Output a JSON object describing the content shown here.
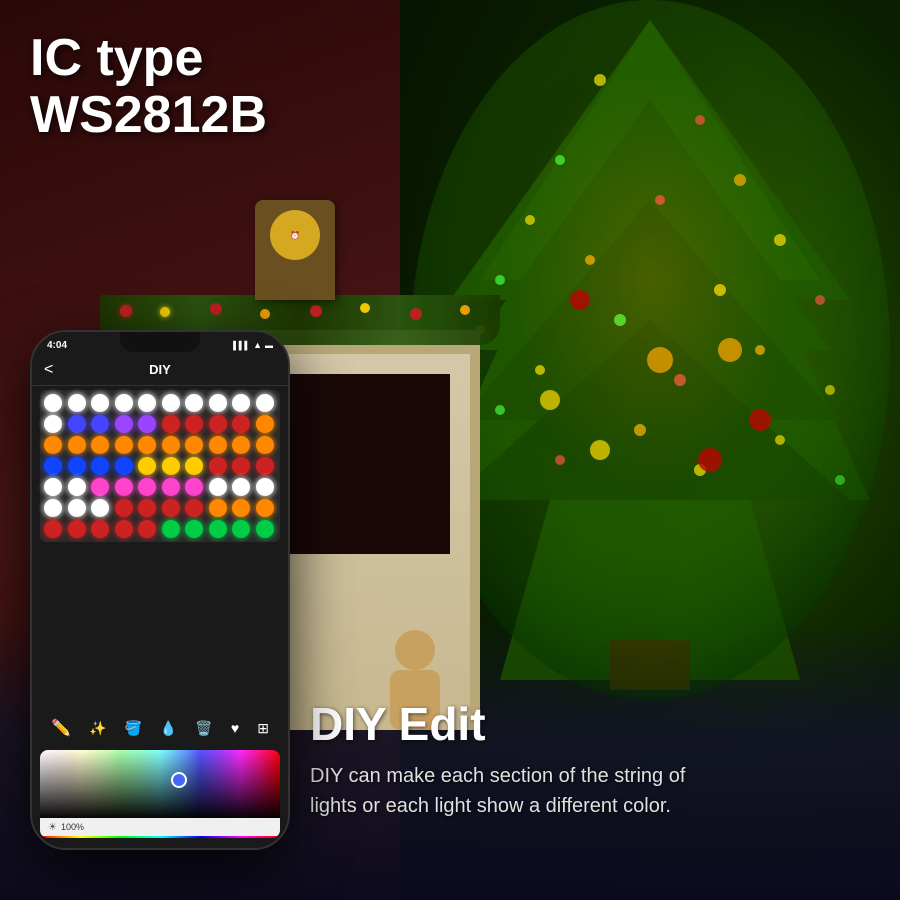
{
  "background": {
    "leftColor": "#2a0808",
    "rightColor": "#1a3000"
  },
  "topText": {
    "line1": "IC type",
    "line2": "WS2812B"
  },
  "phone": {
    "statusBar": {
      "time": "4:04",
      "icons": [
        "signal",
        "wifi",
        "battery"
      ]
    },
    "header": {
      "backLabel": "<",
      "title": "DIY"
    },
    "colorPicker": {
      "brightnessLabel": "100%"
    }
  },
  "bottomSection": {
    "title": "DIY Edit",
    "description": "DIY can make each section of the string of lights or each light show a different color."
  },
  "ledGrid": {
    "rows": [
      [
        "#ffffff",
        "#ffffff",
        "#ffffff",
        "#ffffff",
        "#ffffff",
        "#ffffff",
        "#ffffff",
        "#ffffff",
        "#ffffff",
        "#ffffff"
      ],
      [
        "#ffffff",
        "#4444ff",
        "#4444ff",
        "#9944ff",
        "#9944ff",
        "#cc2222",
        "#cc2222",
        "#cc2222",
        "#cc2222",
        "#ff8800"
      ],
      [
        "#ff8800",
        "#ff8800",
        "#ff8800",
        "#ff8800",
        "#ff8800",
        "#ff8800",
        "#ff8800",
        "#ff8800",
        "#ff8800",
        "#ff8800"
      ],
      [
        "#1144ff",
        "#1144ff",
        "#1144ff",
        "#1144ff",
        "#ffcc00",
        "#ffcc00",
        "#ffcc00",
        "#cc2222",
        "#cc2222",
        "#cc2222"
      ],
      [
        "#ffffff",
        "#ffffff",
        "#ff44cc",
        "#ff44cc",
        "#ff44cc",
        "#ff44cc",
        "#ff44cc",
        "#ffffff",
        "#ffffff",
        "#ffffff"
      ],
      [
        "#ffffff",
        "#ffffff",
        "#ffffff",
        "#cc2222",
        "#cc2222",
        "#cc2222",
        "#cc2222",
        "#ff8800",
        "#ff8800",
        "#ff8800"
      ],
      [
        "#cc2222",
        "#cc2222",
        "#cc2222",
        "#cc2222",
        "#cc2222",
        "#00cc44",
        "#00cc44",
        "#00cc44",
        "#00cc44",
        "#00cc44"
      ]
    ]
  },
  "toolbar": {
    "icons": [
      "pencil",
      "magic",
      "fill",
      "dropper",
      "trash",
      "heart",
      "grid"
    ]
  }
}
